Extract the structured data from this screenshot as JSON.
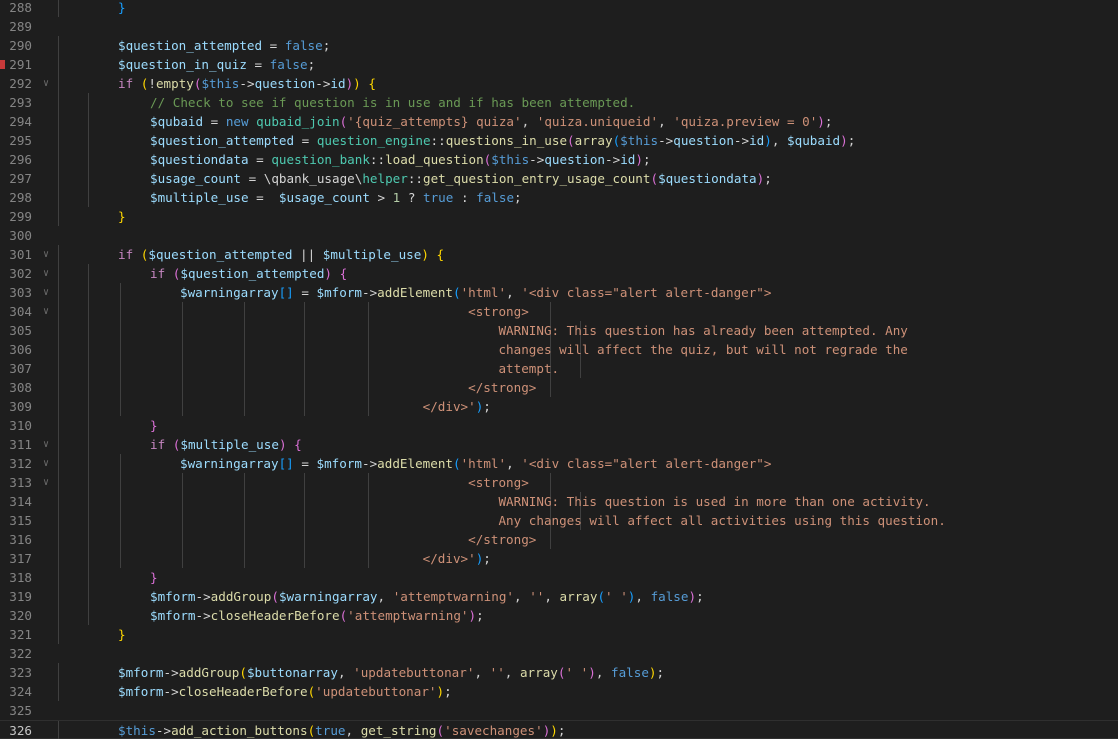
{
  "editor": {
    "current_line": 326,
    "breakpoint_line": 291,
    "colors": {
      "background": "#1e1e1e",
      "variable": "#9cdcfe",
      "keyword": "#569cd6",
      "control": "#c586c0",
      "function": "#dcdcaa",
      "string": "#ce9178",
      "comment": "#6a9955",
      "class": "#4ec9b0",
      "number": "#b5cea8",
      "bracket_level_1": "#ffd700",
      "bracket_level_2": "#da70d6",
      "bracket_level_3": "#179fff"
    },
    "lines": [
      {
        "n": "288",
        "fold": false,
        "indent": 1,
        "tokens": [
          [
            "}",
            "br3"
          ]
        ]
      },
      {
        "n": "289",
        "fold": false,
        "indent": 0,
        "tokens": []
      },
      {
        "n": "290",
        "fold": false,
        "indent": 1,
        "tokens": [
          [
            "$question_attempted",
            "var"
          ],
          [
            " = ",
            "op"
          ],
          [
            "false",
            "kw"
          ],
          [
            ";",
            "op"
          ]
        ]
      },
      {
        "n": "291",
        "fold": false,
        "indent": 1,
        "tokens": [
          [
            "$question_in_quiz",
            "var"
          ],
          [
            " = ",
            "op"
          ],
          [
            "false",
            "kw"
          ],
          [
            ";",
            "op"
          ]
        ]
      },
      {
        "n": "292",
        "fold": true,
        "indent": 1,
        "tokens": [
          [
            "if",
            "ctl"
          ],
          [
            " ",
            "op"
          ],
          [
            "(",
            "br1"
          ],
          [
            "!",
            "op"
          ],
          [
            "empty",
            "fn"
          ],
          [
            "(",
            "br2"
          ],
          [
            "$this",
            "kw"
          ],
          [
            "->",
            "op"
          ],
          [
            "question",
            "var"
          ],
          [
            "->",
            "op"
          ],
          [
            "id",
            "var"
          ],
          [
            ")",
            "br2"
          ],
          [
            ")",
            "br1"
          ],
          [
            " ",
            "op"
          ],
          [
            "{",
            "br1"
          ]
        ]
      },
      {
        "n": "293",
        "fold": false,
        "indent": 2,
        "tokens": [
          [
            "// Check to see if question is in use and if has been attempted.",
            "cmt"
          ]
        ]
      },
      {
        "n": "294",
        "fold": false,
        "indent": 2,
        "tokens": [
          [
            "$qubaid",
            "var"
          ],
          [
            " = ",
            "op"
          ],
          [
            "new",
            "kw"
          ],
          [
            " ",
            "op"
          ],
          [
            "qubaid_join",
            "cls"
          ],
          [
            "(",
            "br2"
          ],
          [
            "'{quiz_attempts} quiza'",
            "str"
          ],
          [
            ", ",
            "op"
          ],
          [
            "'quiza.uniqueid'",
            "str"
          ],
          [
            ", ",
            "op"
          ],
          [
            "'quiza.preview = 0'",
            "str"
          ],
          [
            ")",
            "br2"
          ],
          [
            ";",
            "op"
          ]
        ]
      },
      {
        "n": "295",
        "fold": false,
        "indent": 2,
        "tokens": [
          [
            "$question_attempted",
            "var"
          ],
          [
            " = ",
            "op"
          ],
          [
            "question_engine",
            "cls"
          ],
          [
            "::",
            "op"
          ],
          [
            "questions_in_use",
            "fn"
          ],
          [
            "(",
            "br2"
          ],
          [
            "array",
            "fn"
          ],
          [
            "(",
            "br3"
          ],
          [
            "$this",
            "kw"
          ],
          [
            "->",
            "op"
          ],
          [
            "question",
            "var"
          ],
          [
            "->",
            "op"
          ],
          [
            "id",
            "var"
          ],
          [
            ")",
            "br3"
          ],
          [
            ", ",
            "op"
          ],
          [
            "$qubaid",
            "var"
          ],
          [
            ")",
            "br2"
          ],
          [
            ";",
            "op"
          ]
        ]
      },
      {
        "n": "296",
        "fold": false,
        "indent": 2,
        "tokens": [
          [
            "$questiondata",
            "var"
          ],
          [
            " = ",
            "op"
          ],
          [
            "question_bank",
            "cls"
          ],
          [
            "::",
            "op"
          ],
          [
            "load_question",
            "fn"
          ],
          [
            "(",
            "br2"
          ],
          [
            "$this",
            "kw"
          ],
          [
            "->",
            "op"
          ],
          [
            "question",
            "var"
          ],
          [
            "->",
            "op"
          ],
          [
            "id",
            "var"
          ],
          [
            ")",
            "br2"
          ],
          [
            ";",
            "op"
          ]
        ]
      },
      {
        "n": "297",
        "fold": false,
        "indent": 2,
        "tokens": [
          [
            "$usage_count",
            "var"
          ],
          [
            " = ",
            "op"
          ],
          [
            "\\qbank_usage\\",
            "op"
          ],
          [
            "helper",
            "cls"
          ],
          [
            "::",
            "op"
          ],
          [
            "get_question_entry_usage_count",
            "fn"
          ],
          [
            "(",
            "br2"
          ],
          [
            "$questiondata",
            "var"
          ],
          [
            ")",
            "br2"
          ],
          [
            ";",
            "op"
          ]
        ]
      },
      {
        "n": "298",
        "fold": false,
        "indent": 2,
        "tokens": [
          [
            "$multiple_use",
            "var"
          ],
          [
            " =  ",
            "op"
          ],
          [
            "$usage_count",
            "var"
          ],
          [
            " > ",
            "op"
          ],
          [
            "1",
            "num"
          ],
          [
            " ? ",
            "op"
          ],
          [
            "true",
            "kw"
          ],
          [
            " : ",
            "op"
          ],
          [
            "false",
            "kw"
          ],
          [
            ";",
            "op"
          ]
        ]
      },
      {
        "n": "299",
        "fold": false,
        "indent": 1,
        "tokens": [
          [
            "}",
            "br1"
          ]
        ]
      },
      {
        "n": "300",
        "fold": false,
        "indent": 0,
        "tokens": []
      },
      {
        "n": "301",
        "fold": true,
        "indent": 1,
        "tokens": [
          [
            "if",
            "ctl"
          ],
          [
            " ",
            "op"
          ],
          [
            "(",
            "br1"
          ],
          [
            "$question_attempted",
            "var"
          ],
          [
            " || ",
            "op"
          ],
          [
            "$multiple_use",
            "var"
          ],
          [
            ")",
            "br1"
          ],
          [
            " ",
            "op"
          ],
          [
            "{",
            "br1"
          ]
        ]
      },
      {
        "n": "302",
        "fold": true,
        "indent": 2,
        "tokens": [
          [
            "if",
            "ctl"
          ],
          [
            " ",
            "op"
          ],
          [
            "(",
            "br2"
          ],
          [
            "$question_attempted",
            "var"
          ],
          [
            ")",
            "br2"
          ],
          [
            " ",
            "op"
          ],
          [
            "{",
            "br2"
          ]
        ]
      },
      {
        "n": "303",
        "fold": true,
        "indent": 3,
        "tokens": [
          [
            "$warningarray",
            "var"
          ],
          [
            "[]",
            "br3"
          ],
          [
            " = ",
            "op"
          ],
          [
            "$mform",
            "var"
          ],
          [
            "->",
            "op"
          ],
          [
            "addElement",
            "fn"
          ],
          [
            "(",
            "br3"
          ],
          [
            "'html'",
            "str"
          ],
          [
            ", ",
            "op"
          ],
          [
            "'<div class=\"alert alert-danger\">",
            "str"
          ]
        ]
      },
      {
        "n": "304",
        "fold": true,
        "indent": 3,
        "tokens": [
          [
            "                                      <strong>",
            "str"
          ]
        ]
      },
      {
        "n": "305",
        "fold": false,
        "indent": 3,
        "tokens": [
          [
            "                                          WARNING: This question has already been attempted. Any",
            "str"
          ]
        ]
      },
      {
        "n": "306",
        "fold": false,
        "indent": 3,
        "tokens": [
          [
            "                                          changes will affect the quiz, but will not regrade the",
            "str"
          ]
        ]
      },
      {
        "n": "307",
        "fold": false,
        "indent": 3,
        "tokens": [
          [
            "                                          attempt.",
            "str"
          ]
        ]
      },
      {
        "n": "308",
        "fold": false,
        "indent": 3,
        "tokens": [
          [
            "                                      </strong>",
            "str"
          ]
        ]
      },
      {
        "n": "309",
        "fold": false,
        "indent": 3,
        "tokens": [
          [
            "                                </div>'",
            "str"
          ],
          [
            ")",
            "br3"
          ],
          [
            ";",
            "op"
          ]
        ]
      },
      {
        "n": "310",
        "fold": false,
        "indent": 2,
        "tokens": [
          [
            "}",
            "br2"
          ]
        ]
      },
      {
        "n": "311",
        "fold": true,
        "indent": 2,
        "tokens": [
          [
            "if",
            "ctl"
          ],
          [
            " ",
            "op"
          ],
          [
            "(",
            "br2"
          ],
          [
            "$multiple_use",
            "var"
          ],
          [
            ")",
            "br2"
          ],
          [
            " ",
            "op"
          ],
          [
            "{",
            "br2"
          ]
        ]
      },
      {
        "n": "312",
        "fold": true,
        "indent": 3,
        "tokens": [
          [
            "$warningarray",
            "var"
          ],
          [
            "[]",
            "br3"
          ],
          [
            " = ",
            "op"
          ],
          [
            "$mform",
            "var"
          ],
          [
            "->",
            "op"
          ],
          [
            "addElement",
            "fn"
          ],
          [
            "(",
            "br3"
          ],
          [
            "'html'",
            "str"
          ],
          [
            ", ",
            "op"
          ],
          [
            "'<div class=\"alert alert-danger\">",
            "str"
          ]
        ]
      },
      {
        "n": "313",
        "fold": true,
        "indent": 3,
        "tokens": [
          [
            "                                      <strong>",
            "str"
          ]
        ]
      },
      {
        "n": "314",
        "fold": false,
        "indent": 3,
        "tokens": [
          [
            "                                          WARNING: This question is used in more than one activity.",
            "str"
          ]
        ]
      },
      {
        "n": "315",
        "fold": false,
        "indent": 3,
        "tokens": [
          [
            "                                          Any changes will affect all activities using this question.",
            "str"
          ]
        ]
      },
      {
        "n": "316",
        "fold": false,
        "indent": 3,
        "tokens": [
          [
            "                                      </strong>",
            "str"
          ]
        ]
      },
      {
        "n": "317",
        "fold": false,
        "indent": 3,
        "tokens": [
          [
            "                                </div>'",
            "str"
          ],
          [
            ")",
            "br3"
          ],
          [
            ";",
            "op"
          ]
        ]
      },
      {
        "n": "318",
        "fold": false,
        "indent": 2,
        "tokens": [
          [
            "}",
            "br2"
          ]
        ]
      },
      {
        "n": "319",
        "fold": false,
        "indent": 2,
        "tokens": [
          [
            "$mform",
            "var"
          ],
          [
            "->",
            "op"
          ],
          [
            "addGroup",
            "fn"
          ],
          [
            "(",
            "br2"
          ],
          [
            "$warningarray",
            "var"
          ],
          [
            ", ",
            "op"
          ],
          [
            "'attemptwarning'",
            "str"
          ],
          [
            ", ",
            "op"
          ],
          [
            "''",
            "str"
          ],
          [
            ", ",
            "op"
          ],
          [
            "array",
            "fn"
          ],
          [
            "(",
            "br3"
          ],
          [
            "' '",
            "str"
          ],
          [
            ")",
            "br3"
          ],
          [
            ", ",
            "op"
          ],
          [
            "false",
            "kw"
          ],
          [
            ")",
            "br2"
          ],
          [
            ";",
            "op"
          ]
        ]
      },
      {
        "n": "320",
        "fold": false,
        "indent": 2,
        "tokens": [
          [
            "$mform",
            "var"
          ],
          [
            "->",
            "op"
          ],
          [
            "closeHeaderBefore",
            "fn"
          ],
          [
            "(",
            "br2"
          ],
          [
            "'attemptwarning'",
            "str"
          ],
          [
            ")",
            "br2"
          ],
          [
            ";",
            "op"
          ]
        ]
      },
      {
        "n": "321",
        "fold": false,
        "indent": 1,
        "tokens": [
          [
            "}",
            "br1"
          ]
        ]
      },
      {
        "n": "322",
        "fold": false,
        "indent": 0,
        "tokens": []
      },
      {
        "n": "323",
        "fold": false,
        "indent": 1,
        "tokens": [
          [
            "$mform",
            "var"
          ],
          [
            "->",
            "op"
          ],
          [
            "addGroup",
            "fn"
          ],
          [
            "(",
            "br1"
          ],
          [
            "$buttonarray",
            "var"
          ],
          [
            ", ",
            "op"
          ],
          [
            "'updatebuttonar'",
            "str"
          ],
          [
            ", ",
            "op"
          ],
          [
            "''",
            "str"
          ],
          [
            ", ",
            "op"
          ],
          [
            "array",
            "fn"
          ],
          [
            "(",
            "br2"
          ],
          [
            "' '",
            "str"
          ],
          [
            ")",
            "br2"
          ],
          [
            ", ",
            "op"
          ],
          [
            "false",
            "kw"
          ],
          [
            ")",
            "br1"
          ],
          [
            ";",
            "op"
          ]
        ]
      },
      {
        "n": "324",
        "fold": false,
        "indent": 1,
        "tokens": [
          [
            "$mform",
            "var"
          ],
          [
            "->",
            "op"
          ],
          [
            "closeHeaderBefore",
            "fn"
          ],
          [
            "(",
            "br1"
          ],
          [
            "'updatebuttonar'",
            "str"
          ],
          [
            ")",
            "br1"
          ],
          [
            ";",
            "op"
          ]
        ]
      },
      {
        "n": "325",
        "fold": false,
        "indent": 0,
        "tokens": []
      },
      {
        "n": "326",
        "fold": false,
        "indent": 1,
        "tokens": [
          [
            "$this",
            "kw"
          ],
          [
            "->",
            "op"
          ],
          [
            "add_action_buttons",
            "fn"
          ],
          [
            "(",
            "br1"
          ],
          [
            "true",
            "kw"
          ],
          [
            ", ",
            "op"
          ],
          [
            "get_string",
            "fn"
          ],
          [
            "(",
            "br2"
          ],
          [
            "'savechanges'",
            "str"
          ],
          [
            ")",
            "br2"
          ],
          [
            ")",
            "br1"
          ],
          [
            ";",
            "op"
          ]
        ]
      }
    ]
  }
}
